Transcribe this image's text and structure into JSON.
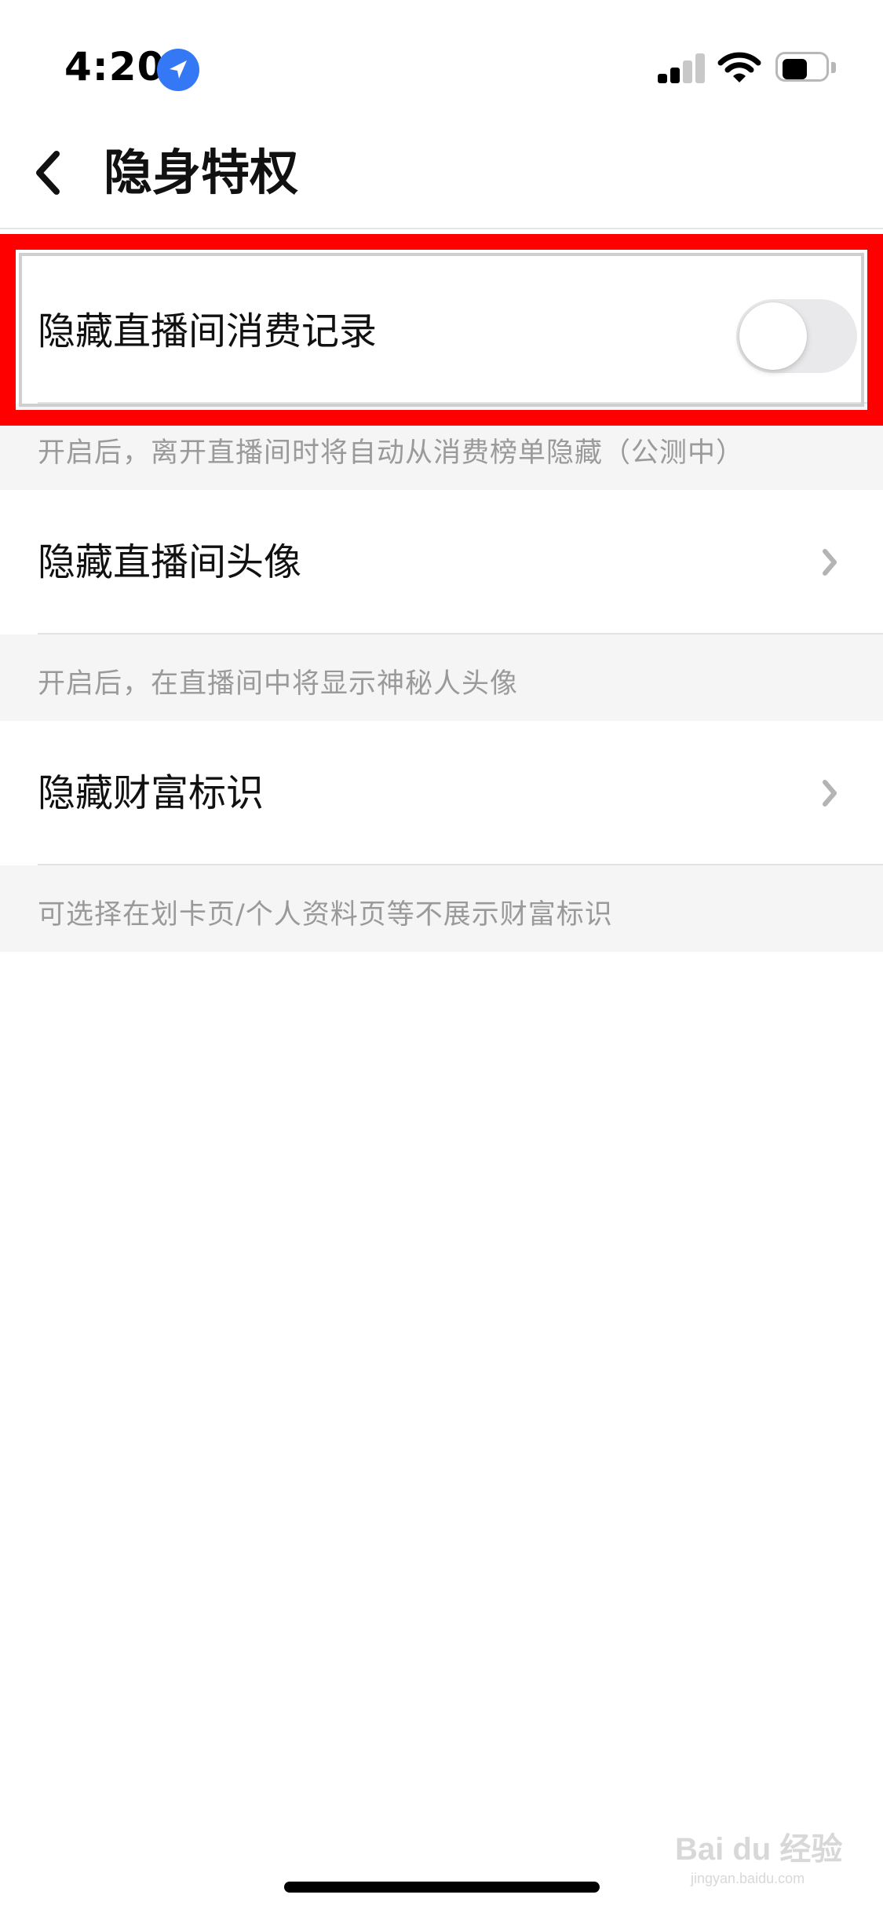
{
  "status_bar": {
    "time": "4:20",
    "location_icon": "location-arrow-icon",
    "signal_icon": "cellular-signal-icon",
    "wifi_icon": "wifi-icon",
    "battery_icon": "battery-icon",
    "signal_bars_active": 2,
    "signal_bars_total": 4,
    "battery_fraction": 0.55
  },
  "nav": {
    "back_icon": "chevron-left-icon",
    "title": "隐身特权"
  },
  "settings": [
    {
      "label": "隐藏直播间消费记录",
      "control": "toggle",
      "toggle_on": false,
      "note": "开启后，离开直播间时将自动从消费榜单隐藏（公测中）"
    },
    {
      "label": "隐藏直播间头像",
      "control": "chevron",
      "note": "开启后，在直播间中将显示神秘人头像"
    },
    {
      "label": "隐藏财富标识",
      "control": "chevron",
      "note": "可选择在划卡页/个人资料页等不展示财富标识"
    }
  ],
  "colors": {
    "highlight": "#ff0000",
    "toggle_off": "#e9e9eb",
    "note_background": "#f5f5f5",
    "note_text": "#9a9a9a",
    "location_blue": "#3478f6"
  },
  "watermark": {
    "brand": "Bai du 经验",
    "url": "jingyan.baidu.com"
  }
}
